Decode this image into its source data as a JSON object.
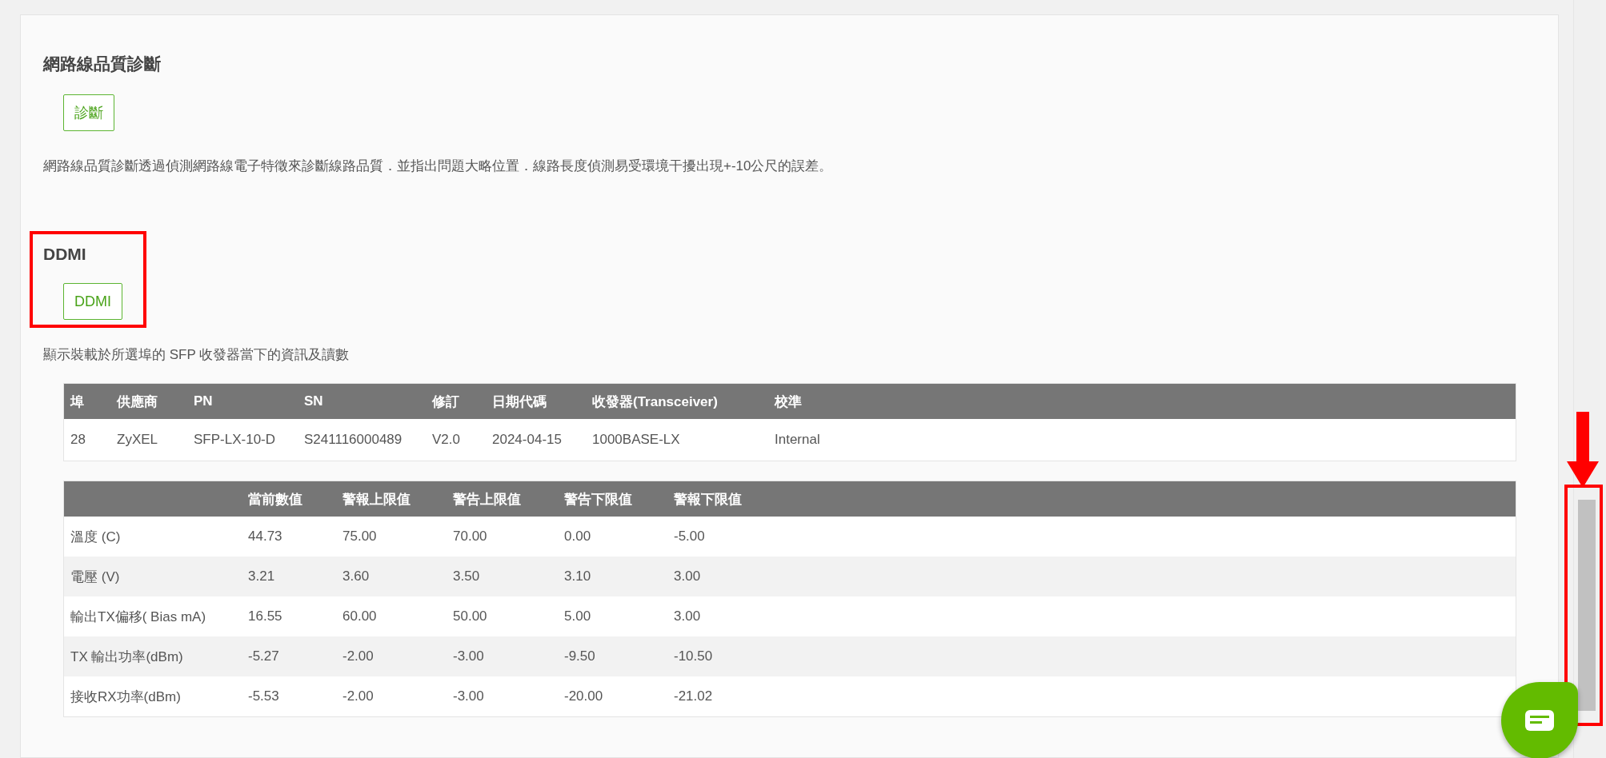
{
  "sections": [
    {
      "title": "網路線品質診斷",
      "button": "診斷",
      "highlighted": false,
      "description": "網路線品質診斷透過偵測網路線電子特徵來診斷線路品質．並指出問題大略位置．線路長度偵測易受環境干擾出現+-10公尺的誤差。"
    },
    {
      "title": "DDMI",
      "button": "DDMI",
      "highlighted": true,
      "description": "顯示裝載於所選埠的 SFP 收發器當下的資訊及讀數"
    }
  ],
  "transceiver_table": {
    "columns": [
      "埠",
      "供應商",
      "PN",
      "SN",
      "修訂",
      "日期代碼",
      "收發器(Transceiver)",
      "校準"
    ],
    "rows": [
      [
        "28",
        "ZyXEL",
        "SFP-LX-10-D",
        "S241116000489",
        "V2.0",
        "2024-04-15",
        "1000BASE-LX",
        "Internal"
      ]
    ]
  },
  "ddmi_table": {
    "columns": [
      "當前數值",
      "警報上限值",
      "警告上限值",
      "警告下限值",
      "警報下限值"
    ],
    "rows": [
      {
        "label": "溫度 (C)",
        "values": [
          "44.73",
          "75.00",
          "70.00",
          "0.00",
          "-5.00"
        ]
      },
      {
        "label": "電壓 (V)",
        "values": [
          "3.21",
          "3.60",
          "3.50",
          "3.10",
          "3.00"
        ]
      },
      {
        "label": "輸出TX偏移( Bias mA)",
        "values": [
          "16.55",
          "60.00",
          "50.00",
          "5.00",
          "3.00"
        ]
      },
      {
        "label": "TX 輸出功率(dBm)",
        "values": [
          "-5.27",
          "-2.00",
          "-3.00",
          "-9.50",
          "-10.50"
        ]
      },
      {
        "label": "接收RX功率(dBm)",
        "values": [
          "-5.53",
          "-2.00",
          "-3.00",
          "-20.00",
          "-21.02"
        ]
      }
    ]
  },
  "scrollbar": {
    "highlighted": true
  }
}
